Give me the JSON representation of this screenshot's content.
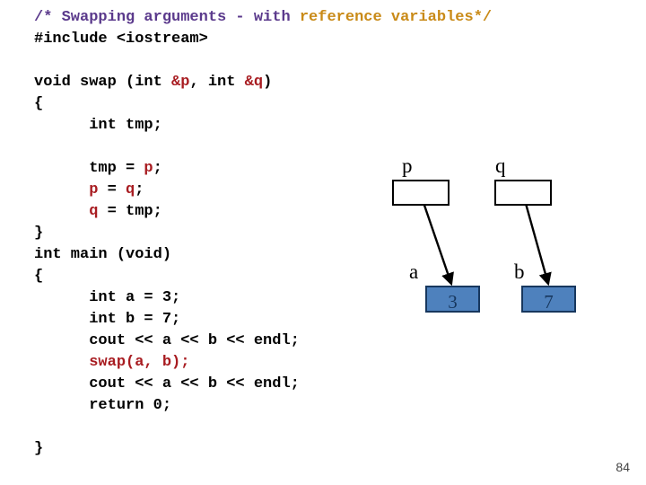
{
  "slide": {
    "page_number": "84",
    "background": "#ffffff"
  },
  "colors": {
    "comment_purple": "#5B3A8C",
    "comment_orange": "#C98A17",
    "reference_red": "#A81C21",
    "code_black": "#000000",
    "value_box_fill": "#4E81BD",
    "value_box_border": "#17375E",
    "pointer_box_fill": "#ffffff",
    "pointer_box_border": "#000000"
  },
  "code": {
    "lines": [
      {
        "id": "line-comment",
        "segments": [
          {
            "text": "/* Swapping arguments - with ",
            "color": "purple"
          },
          {
            "text": "reference variables*/",
            "color": "orange"
          }
        ]
      },
      {
        "id": "line-include",
        "segments": [
          {
            "text": "#include <iostream>",
            "color": "black"
          }
        ]
      },
      {
        "id": "line-blank-1",
        "segments": [
          {
            "text": "",
            "color": "black"
          }
        ]
      },
      {
        "id": "line-swap-sig",
        "segments": [
          {
            "text": "void swap (int ",
            "color": "black"
          },
          {
            "text": "&p",
            "color": "red"
          },
          {
            "text": ", int ",
            "color": "black"
          },
          {
            "text": "&q",
            "color": "red"
          },
          {
            "text": ")",
            "color": "black"
          }
        ]
      },
      {
        "id": "line-swap-open",
        "segments": [
          {
            "text": "{",
            "color": "black"
          }
        ]
      },
      {
        "id": "line-tmp-decl",
        "segments": [
          {
            "text": "      int tmp;",
            "color": "black"
          }
        ]
      },
      {
        "id": "line-blank-2",
        "segments": [
          {
            "text": "",
            "color": "black"
          }
        ]
      },
      {
        "id": "line-tmp-assign",
        "segments": [
          {
            "text": "      tmp = ",
            "color": "black"
          },
          {
            "text": "p",
            "color": "red"
          },
          {
            "text": ";",
            "color": "black"
          }
        ]
      },
      {
        "id": "line-p-assign",
        "segments": [
          {
            "text": "      ",
            "color": "black"
          },
          {
            "text": "p",
            "color": "red"
          },
          {
            "text": " = ",
            "color": "black"
          },
          {
            "text": "q",
            "color": "red"
          },
          {
            "text": ";",
            "color": "black"
          }
        ]
      },
      {
        "id": "line-q-assign",
        "segments": [
          {
            "text": "      ",
            "color": "black"
          },
          {
            "text": "q",
            "color": "red"
          },
          {
            "text": " = tmp;",
            "color": "black"
          }
        ]
      },
      {
        "id": "line-swap-close",
        "segments": [
          {
            "text": "}",
            "color": "black"
          }
        ]
      },
      {
        "id": "line-main-sig",
        "segments": [
          {
            "text": "int main (void)",
            "color": "black"
          }
        ]
      },
      {
        "id": "line-main-open",
        "segments": [
          {
            "text": "{",
            "color": "black"
          }
        ]
      },
      {
        "id": "line-a-decl",
        "segments": [
          {
            "text": "      int a = 3;",
            "color": "black"
          }
        ]
      },
      {
        "id": "line-b-decl",
        "segments": [
          {
            "text": "      int b = 7;",
            "color": "black"
          }
        ]
      },
      {
        "id": "line-cout-1",
        "segments": [
          {
            "text": "      cout << a << b << endl;",
            "color": "black"
          }
        ]
      },
      {
        "id": "line-swap-call",
        "segments": [
          {
            "text": "      ",
            "color": "black"
          },
          {
            "text": "swap(a, b);",
            "color": "red"
          }
        ]
      },
      {
        "id": "line-cout-2",
        "segments": [
          {
            "text": "      cout << a << b << endl;",
            "color": "black"
          }
        ]
      },
      {
        "id": "line-return",
        "segments": [
          {
            "text": "      return 0;",
            "color": "black"
          }
        ]
      },
      {
        "id": "line-blank-3",
        "segments": [
          {
            "text": "",
            "color": "black"
          }
        ]
      },
      {
        "id": "line-main-close",
        "segments": [
          {
            "text": "}",
            "color": "black"
          }
        ]
      }
    ]
  },
  "diagram": {
    "pointer_p": {
      "label": "p",
      "value": ""
    },
    "pointer_q": {
      "label": "q",
      "value": ""
    },
    "variable_a": {
      "label": "a",
      "value": "3"
    },
    "variable_b": {
      "label": "b",
      "value": "7"
    },
    "arrows": [
      {
        "id": "arrow-p-to-a",
        "from": "pointer_p",
        "to": "variable_a"
      },
      {
        "id": "arrow-q-to-b",
        "from": "pointer_q",
        "to": "variable_b"
      }
    ]
  }
}
